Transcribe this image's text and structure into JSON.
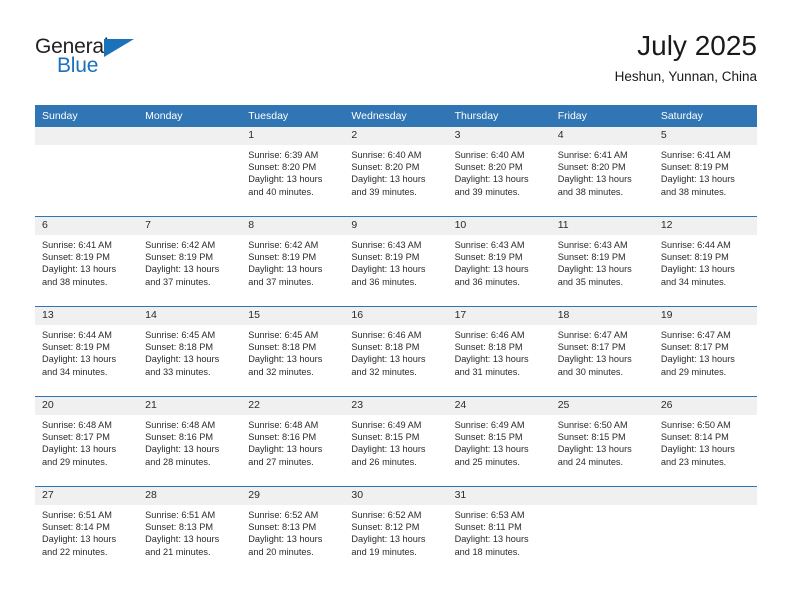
{
  "brand": {
    "name_part1": "General",
    "name_part2": "Blue",
    "triangle_color": "#1b72bb"
  },
  "header": {
    "month_title": "July 2025",
    "location": "Heshun, Yunnan, China"
  },
  "theme": {
    "header_blue": "#3075b4",
    "date_band_gray": "#f0f0f0",
    "text_color": "#2b2b2b"
  },
  "weekday_headers": [
    "Sunday",
    "Monday",
    "Tuesday",
    "Wednesday",
    "Thursday",
    "Friday",
    "Saturday"
  ],
  "weeks": [
    [
      {
        "day": "",
        "sunrise": "",
        "sunset": "",
        "daylight": ""
      },
      {
        "day": "",
        "sunrise": "",
        "sunset": "",
        "daylight": ""
      },
      {
        "day": "1",
        "sunrise": "Sunrise: 6:39 AM",
        "sunset": "Sunset: 8:20 PM",
        "daylight": "Daylight: 13 hours and 40 minutes."
      },
      {
        "day": "2",
        "sunrise": "Sunrise: 6:40 AM",
        "sunset": "Sunset: 8:20 PM",
        "daylight": "Daylight: 13 hours and 39 minutes."
      },
      {
        "day": "3",
        "sunrise": "Sunrise: 6:40 AM",
        "sunset": "Sunset: 8:20 PM",
        "daylight": "Daylight: 13 hours and 39 minutes."
      },
      {
        "day": "4",
        "sunrise": "Sunrise: 6:41 AM",
        "sunset": "Sunset: 8:20 PM",
        "daylight": "Daylight: 13 hours and 38 minutes."
      },
      {
        "day": "5",
        "sunrise": "Sunrise: 6:41 AM",
        "sunset": "Sunset: 8:19 PM",
        "daylight": "Daylight: 13 hours and 38 minutes."
      }
    ],
    [
      {
        "day": "6",
        "sunrise": "Sunrise: 6:41 AM",
        "sunset": "Sunset: 8:19 PM",
        "daylight": "Daylight: 13 hours and 38 minutes."
      },
      {
        "day": "7",
        "sunrise": "Sunrise: 6:42 AM",
        "sunset": "Sunset: 8:19 PM",
        "daylight": "Daylight: 13 hours and 37 minutes."
      },
      {
        "day": "8",
        "sunrise": "Sunrise: 6:42 AM",
        "sunset": "Sunset: 8:19 PM",
        "daylight": "Daylight: 13 hours and 37 minutes."
      },
      {
        "day": "9",
        "sunrise": "Sunrise: 6:43 AM",
        "sunset": "Sunset: 8:19 PM",
        "daylight": "Daylight: 13 hours and 36 minutes."
      },
      {
        "day": "10",
        "sunrise": "Sunrise: 6:43 AM",
        "sunset": "Sunset: 8:19 PM",
        "daylight": "Daylight: 13 hours and 36 minutes."
      },
      {
        "day": "11",
        "sunrise": "Sunrise: 6:43 AM",
        "sunset": "Sunset: 8:19 PM",
        "daylight": "Daylight: 13 hours and 35 minutes."
      },
      {
        "day": "12",
        "sunrise": "Sunrise: 6:44 AM",
        "sunset": "Sunset: 8:19 PM",
        "daylight": "Daylight: 13 hours and 34 minutes."
      }
    ],
    [
      {
        "day": "13",
        "sunrise": "Sunrise: 6:44 AM",
        "sunset": "Sunset: 8:19 PM",
        "daylight": "Daylight: 13 hours and 34 minutes."
      },
      {
        "day": "14",
        "sunrise": "Sunrise: 6:45 AM",
        "sunset": "Sunset: 8:18 PM",
        "daylight": "Daylight: 13 hours and 33 minutes."
      },
      {
        "day": "15",
        "sunrise": "Sunrise: 6:45 AM",
        "sunset": "Sunset: 8:18 PM",
        "daylight": "Daylight: 13 hours and 32 minutes."
      },
      {
        "day": "16",
        "sunrise": "Sunrise: 6:46 AM",
        "sunset": "Sunset: 8:18 PM",
        "daylight": "Daylight: 13 hours and 32 minutes."
      },
      {
        "day": "17",
        "sunrise": "Sunrise: 6:46 AM",
        "sunset": "Sunset: 8:18 PM",
        "daylight": "Daylight: 13 hours and 31 minutes."
      },
      {
        "day": "18",
        "sunrise": "Sunrise: 6:47 AM",
        "sunset": "Sunset: 8:17 PM",
        "daylight": "Daylight: 13 hours and 30 minutes."
      },
      {
        "day": "19",
        "sunrise": "Sunrise: 6:47 AM",
        "sunset": "Sunset: 8:17 PM",
        "daylight": "Daylight: 13 hours and 29 minutes."
      }
    ],
    [
      {
        "day": "20",
        "sunrise": "Sunrise: 6:48 AM",
        "sunset": "Sunset: 8:17 PM",
        "daylight": "Daylight: 13 hours and 29 minutes."
      },
      {
        "day": "21",
        "sunrise": "Sunrise: 6:48 AM",
        "sunset": "Sunset: 8:16 PM",
        "daylight": "Daylight: 13 hours and 28 minutes."
      },
      {
        "day": "22",
        "sunrise": "Sunrise: 6:48 AM",
        "sunset": "Sunset: 8:16 PM",
        "daylight": "Daylight: 13 hours and 27 minutes."
      },
      {
        "day": "23",
        "sunrise": "Sunrise: 6:49 AM",
        "sunset": "Sunset: 8:15 PM",
        "daylight": "Daylight: 13 hours and 26 minutes."
      },
      {
        "day": "24",
        "sunrise": "Sunrise: 6:49 AM",
        "sunset": "Sunset: 8:15 PM",
        "daylight": "Daylight: 13 hours and 25 minutes."
      },
      {
        "day": "25",
        "sunrise": "Sunrise: 6:50 AM",
        "sunset": "Sunset: 8:15 PM",
        "daylight": "Daylight: 13 hours and 24 minutes."
      },
      {
        "day": "26",
        "sunrise": "Sunrise: 6:50 AM",
        "sunset": "Sunset: 8:14 PM",
        "daylight": "Daylight: 13 hours and 23 minutes."
      }
    ],
    [
      {
        "day": "27",
        "sunrise": "Sunrise: 6:51 AM",
        "sunset": "Sunset: 8:14 PM",
        "daylight": "Daylight: 13 hours and 22 minutes."
      },
      {
        "day": "28",
        "sunrise": "Sunrise: 6:51 AM",
        "sunset": "Sunset: 8:13 PM",
        "daylight": "Daylight: 13 hours and 21 minutes."
      },
      {
        "day": "29",
        "sunrise": "Sunrise: 6:52 AM",
        "sunset": "Sunset: 8:13 PM",
        "daylight": "Daylight: 13 hours and 20 minutes."
      },
      {
        "day": "30",
        "sunrise": "Sunrise: 6:52 AM",
        "sunset": "Sunset: 8:12 PM",
        "daylight": "Daylight: 13 hours and 19 minutes."
      },
      {
        "day": "31",
        "sunrise": "Sunrise: 6:53 AM",
        "sunset": "Sunset: 8:11 PM",
        "daylight": "Daylight: 13 hours and 18 minutes."
      },
      {
        "day": "",
        "sunrise": "",
        "sunset": "",
        "daylight": ""
      },
      {
        "day": "",
        "sunrise": "",
        "sunset": "",
        "daylight": ""
      }
    ]
  ]
}
